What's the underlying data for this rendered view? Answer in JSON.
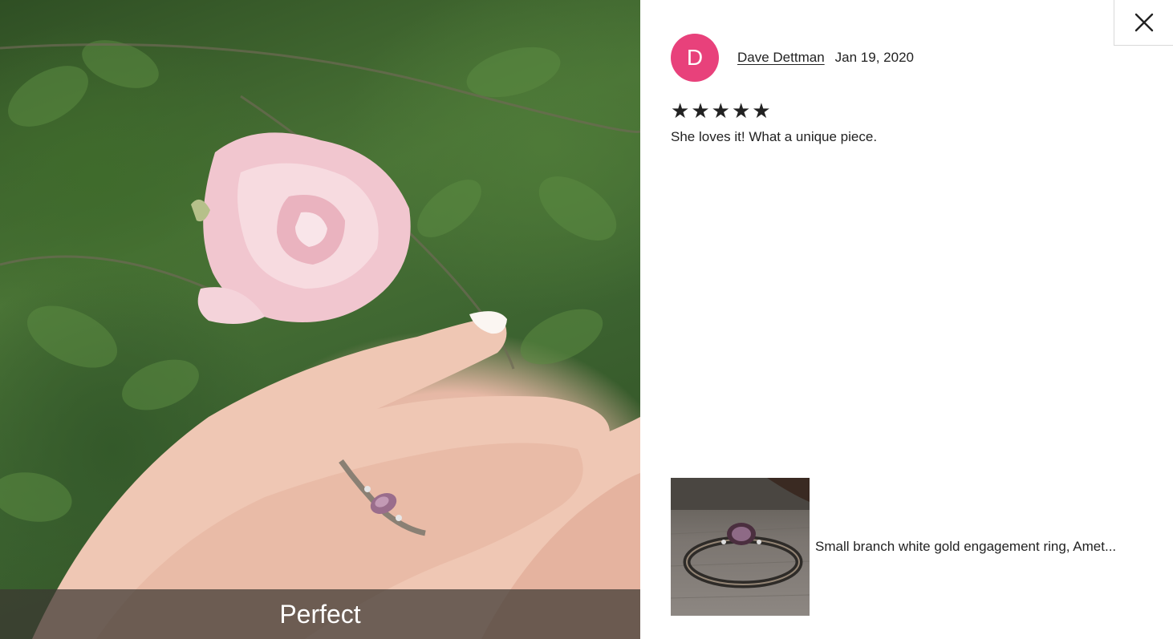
{
  "photo": {
    "caption": "Perfect"
  },
  "close": {
    "icon": "close-icon"
  },
  "review": {
    "avatar_initial": "D",
    "avatar_color": "#e8417b",
    "reviewer_name": "Dave Dettman",
    "date": "Jan 19, 2020",
    "rating": 5,
    "rating_max": 5,
    "stars": [
      "★",
      "★",
      "★",
      "★",
      "★"
    ],
    "text": "She loves it! What a unique piece."
  },
  "product": {
    "title": "Small branch white gold engagement ring, Amet..."
  }
}
